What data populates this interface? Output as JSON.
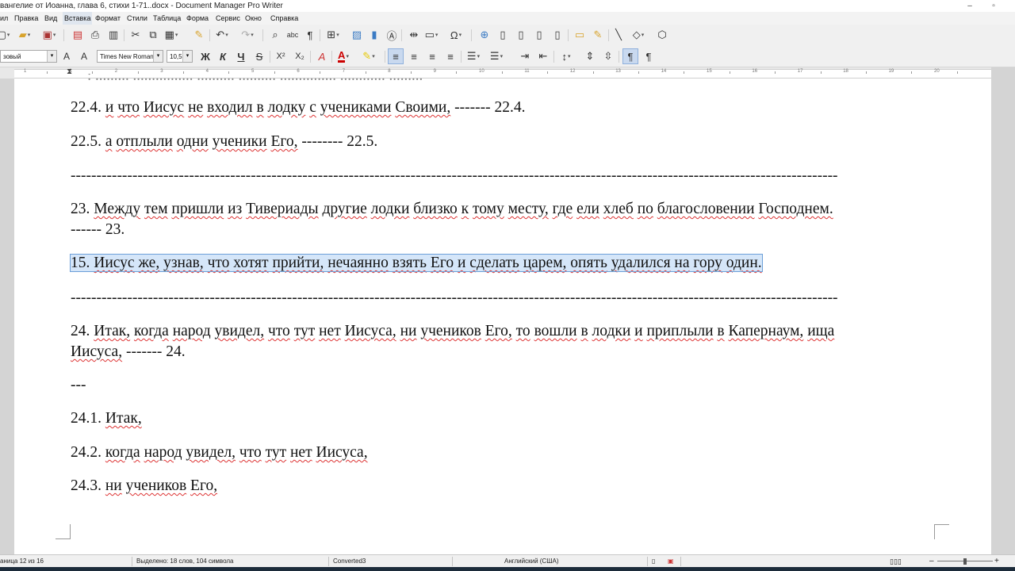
{
  "window": {
    "title": "вангелие от Иоанна, глава 6, стихи 1-71..docx - Document Manager Pro Writer",
    "minimize": "–",
    "restore": "▫"
  },
  "menu": [
    "ил",
    "Правка",
    "Вид",
    "Вставка",
    "Формат",
    "Стили",
    "Таблица",
    "Форма",
    "Сервис",
    "Окно",
    "Справка"
  ],
  "format_toolbar": {
    "paragraph_style": "зовый",
    "font_name": "Times New Roman",
    "font_size": "10,5",
    "bold": "Ж",
    "italic": "К",
    "underline": "Ч",
    "strike": "S",
    "superscript": "X²",
    "subscript": "X₂"
  },
  "ruler": {
    "numbers": [
      "1",
      "1",
      "2",
      "3",
      "4",
      "5",
      "6",
      "7",
      "8",
      "9",
      "10",
      "11",
      "12",
      "13",
      "14",
      "15",
      "16",
      "17",
      "18",
      "19",
      "20"
    ]
  },
  "document": {
    "lines": [
      {
        "segments": [
          {
            "t": "22.4. "
          },
          {
            "t": "и",
            "u": true
          },
          {
            "t": " "
          },
          {
            "t": "что",
            "u": true
          },
          {
            "t": " "
          },
          {
            "t": "Иисус",
            "u": true
          },
          {
            "t": " "
          },
          {
            "t": "не",
            "u": true
          },
          {
            "t": " "
          },
          {
            "t": "входил",
            "u": true
          },
          {
            "t": " "
          },
          {
            "t": "в",
            "u": true
          },
          {
            "t": " "
          },
          {
            "t": "лодку",
            "u": true
          },
          {
            "t": " "
          },
          {
            "t": "с",
            "u": true
          },
          {
            "t": " "
          },
          {
            "t": "учениками",
            "u": true
          },
          {
            "t": " "
          },
          {
            "t": "Своими,",
            "u": true
          },
          {
            "t": " ------- 22.4."
          }
        ]
      },
      {
        "segments": [
          {
            "t": "22.5. "
          },
          {
            "t": "а",
            "u": true
          },
          {
            "t": " "
          },
          {
            "t": "отплыли",
            "u": true
          },
          {
            "t": " "
          },
          {
            "t": "одни",
            "u": true
          },
          {
            "t": " "
          },
          {
            "t": "ученики",
            "u": true
          },
          {
            "t": " "
          },
          {
            "t": "Его,",
            "u": true
          },
          {
            "t": " -------- 22.5."
          }
        ]
      },
      {
        "segments": [
          {
            "t": "-----------------------------------------------------------------------------------------------------------------------------------------------------"
          }
        ]
      },
      {
        "segments": [
          {
            "t": "23. "
          },
          {
            "t": "Между",
            "u": true
          },
          {
            "t": " "
          },
          {
            "t": "тем",
            "u": true
          },
          {
            "t": " "
          },
          {
            "t": "пришли",
            "u": true
          },
          {
            "t": " "
          },
          {
            "t": "из",
            "u": true
          },
          {
            "t": " "
          },
          {
            "t": "Тивериады",
            "u": true
          },
          {
            "t": " "
          },
          {
            "t": "другие",
            "u": true
          },
          {
            "t": " "
          },
          {
            "t": "лодки",
            "u": true
          },
          {
            "t": " "
          },
          {
            "t": "близко",
            "u": true
          },
          {
            "t": " "
          },
          {
            "t": "к",
            "u": true
          },
          {
            "t": " "
          },
          {
            "t": "тому",
            "u": true
          },
          {
            "t": " "
          },
          {
            "t": "месту,",
            "u": true
          },
          {
            "t": " "
          },
          {
            "t": "где",
            "u": true
          },
          {
            "t": " "
          },
          {
            "t": "ели",
            "u": true
          },
          {
            "t": " "
          },
          {
            "t": "хлеб",
            "u": true
          },
          {
            "t": " "
          },
          {
            "t": "по",
            "u": true
          },
          {
            "t": " "
          },
          {
            "t": "благословении",
            "u": true
          },
          {
            "t": " "
          },
          {
            "t": "Господнем.",
            "u": true
          }
        ]
      },
      {
        "segments": [
          {
            "t": "------ 23."
          }
        ]
      },
      {
        "selected": true,
        "segments": [
          {
            "t": "15. "
          },
          {
            "t": "Иисус",
            "u": true
          },
          {
            "t": " "
          },
          {
            "t": "же,",
            "u": true
          },
          {
            "t": " "
          },
          {
            "t": "узнав,",
            "u": true
          },
          {
            "t": " "
          },
          {
            "t": "что",
            "u": true
          },
          {
            "t": " "
          },
          {
            "t": "хотят",
            "u": true
          },
          {
            "t": " "
          },
          {
            "t": "прийти,",
            "u": true
          },
          {
            "t": " "
          },
          {
            "t": "нечаянно",
            "u": true
          },
          {
            "t": " "
          },
          {
            "t": "взять",
            "u": true
          },
          {
            "t": " "
          },
          {
            "t": "Его",
            "u": true
          },
          {
            "t": " "
          },
          {
            "t": "и",
            "u": true
          },
          {
            "t": " "
          },
          {
            "t": "сделать",
            "u": true
          },
          {
            "t": " "
          },
          {
            "t": "царем,",
            "u": true
          },
          {
            "t": " "
          },
          {
            "t": "опять",
            "u": true
          },
          {
            "t": " "
          },
          {
            "t": "удалился",
            "u": true
          },
          {
            "t": " "
          },
          {
            "t": "на",
            "u": true
          },
          {
            "t": " "
          },
          {
            "t": "гору",
            "u": true
          },
          {
            "t": " "
          },
          {
            "t": "один.",
            "u": true
          }
        ]
      },
      {
        "segments": [
          {
            "t": "-----------------------------------------------------------------------------------------------------------------------------------------------------"
          }
        ]
      },
      {
        "segments": [
          {
            "t": "24. "
          },
          {
            "t": "Итак,",
            "u": true
          },
          {
            "t": " "
          },
          {
            "t": "когда",
            "u": true
          },
          {
            "t": " "
          },
          {
            "t": "народ",
            "u": true
          },
          {
            "t": " "
          },
          {
            "t": "увидел,",
            "u": true
          },
          {
            "t": " "
          },
          {
            "t": "что",
            "u": true
          },
          {
            "t": " "
          },
          {
            "t": "тут",
            "u": true
          },
          {
            "t": " "
          },
          {
            "t": "нет",
            "u": true
          },
          {
            "t": " "
          },
          {
            "t": "Иисуса,",
            "u": true
          },
          {
            "t": " "
          },
          {
            "t": "ни",
            "u": true
          },
          {
            "t": " "
          },
          {
            "t": "учеников",
            "u": true
          },
          {
            "t": " "
          },
          {
            "t": "Его,",
            "u": true
          },
          {
            "t": " "
          },
          {
            "t": "то",
            "u": true
          },
          {
            "t": " "
          },
          {
            "t": "вошли",
            "u": true
          },
          {
            "t": " "
          },
          {
            "t": "в",
            "u": true
          },
          {
            "t": " "
          },
          {
            "t": "лодки",
            "u": true
          },
          {
            "t": " "
          },
          {
            "t": "и",
            "u": true
          },
          {
            "t": " "
          },
          {
            "t": "приплыли",
            "u": true
          },
          {
            "t": " "
          },
          {
            "t": "в",
            "u": true
          },
          {
            "t": " "
          },
          {
            "t": "Капернаум,",
            "u": true
          },
          {
            "t": " "
          },
          {
            "t": "ища",
            "u": true
          }
        ]
      },
      {
        "segments": [
          {
            "t": "Иисуса,",
            "u": true
          },
          {
            "t": " ------- 24."
          }
        ]
      },
      {
        "segments": [
          {
            "t": "---"
          }
        ]
      },
      {
        "segments": [
          {
            "t": "24.1. "
          },
          {
            "t": "Итак,",
            "u": true
          }
        ]
      },
      {
        "segments": [
          {
            "t": "24.2. "
          },
          {
            "t": "когда",
            "u": true
          },
          {
            "t": " "
          },
          {
            "t": "народ",
            "u": true
          },
          {
            "t": " "
          },
          {
            "t": "увидел,",
            "u": true
          },
          {
            "t": " "
          },
          {
            "t": "что",
            "u": true
          },
          {
            "t": " "
          },
          {
            "t": "тут",
            "u": true
          },
          {
            "t": " "
          },
          {
            "t": "нет",
            "u": true
          },
          {
            "t": " "
          },
          {
            "t": "Иисуса,",
            "u": true
          }
        ]
      },
      {
        "segments": [
          {
            "t": "24.3. "
          },
          {
            "t": "ни",
            "u": true
          },
          {
            "t": " "
          },
          {
            "t": "учеников",
            "u": true
          },
          {
            "t": " "
          },
          {
            "t": "Его,",
            "u": true
          }
        ]
      }
    ]
  },
  "status": {
    "page": "аница 12 из 16",
    "selection": "Выделено: 18 слов, 104 символа",
    "style": "Converted3",
    "language": "Английский (США)",
    "zoom_minus": "–",
    "zoom_plus": "+"
  }
}
